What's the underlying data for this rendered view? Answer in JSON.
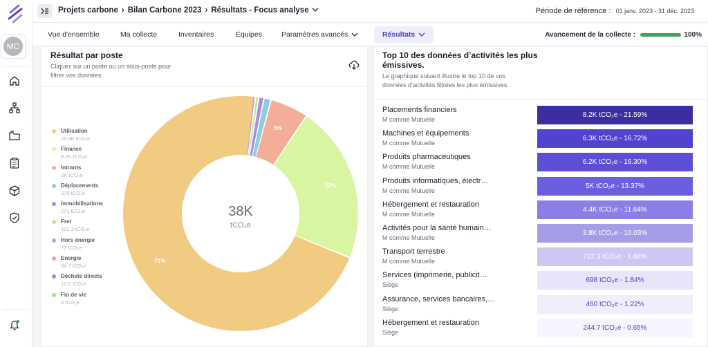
{
  "sidebar": {
    "avatar_initials": "MC",
    "icons": [
      "home-icon",
      "org-chart-icon",
      "folder-icon",
      "clipboard-icon",
      "cube-icon",
      "shield-check-icon",
      "bell-icon"
    ]
  },
  "header": {
    "breadcrumb": [
      "Projets carbone",
      "Bilan Carbone 2023",
      "Résultats - Focus analyse"
    ],
    "period_label": "Période de référence :",
    "period_value": "01 janv. 2023 - 31 déc. 2023"
  },
  "tabs": [
    "Vue d'ensemble",
    "Ma collecte",
    "Inventaires",
    "Équipes",
    "Paramètres avancés",
    "Résultats"
  ],
  "progress": {
    "label": "Avancement de la collecte :",
    "value": 100,
    "text": "100%"
  },
  "left_panel": {
    "title": "Résultat par poste",
    "subtitle_line1": "Cliquez sur un poste ou un sous-poste pour",
    "subtitle_line2": "filtrer vos données.",
    "center_value": "38K",
    "center_unit": "tCO₂e"
  },
  "chart_data": {
    "type": "pie",
    "total": "38K",
    "unit": "tCO₂e",
    "series": [
      {
        "name": "Utilisation",
        "value": 26.8,
        "value_label": "26.8K tCO₂e",
        "color": "#f2cb82",
        "label": "71%"
      },
      {
        "name": "Finance",
        "value": 8.2,
        "value_label": "8.2K tCO₂e",
        "color": "#d8f5a2",
        "label": "22%"
      },
      {
        "name": "Intrants",
        "value": 2.0,
        "value_label": "2K tCO₂e",
        "color": "#f4ae98",
        "label": "5%"
      },
      {
        "name": "Déplacements",
        "value": 0.375,
        "value_label": "375 tCO₂e",
        "color": "#8ecbe4",
        "label": ""
      },
      {
        "name": "Immobilisations",
        "value": 0.271,
        "value_label": "271 tCO₂e",
        "color": "#a58fe4",
        "label": ""
      },
      {
        "name": "Fret",
        "value": 0.1023,
        "value_label": "102.3 tCO₂e",
        "color": "#bde89a",
        "label": ""
      },
      {
        "name": "Hors énergie",
        "value": 0.077,
        "value_label": "77 tCO₂e",
        "color": "#c499e6",
        "label": ""
      },
      {
        "name": "Energie",
        "value": 0.0347,
        "value_label": "34.7 tCO₂e",
        "color": "#f6a09a",
        "label": ""
      },
      {
        "name": "Déchets directs",
        "value": 0.0125,
        "value_label": "12.5 tCO₂e",
        "color": "#8f8fe0",
        "label": ""
      },
      {
        "name": "Fin de vie",
        "value": 0.009,
        "value_label": "9 tCO₂e",
        "color": "#a8e48a",
        "label": ""
      }
    ]
  },
  "right_panel": {
    "title_line1": "Top 10 des données d’activités les plus",
    "title_line2": "émissives.",
    "subtitle_line1": "Le graphique suivant illustre le top 10 de vos",
    "subtitle_line2": "données d'activités filtrées les plus émissives.",
    "rows": [
      {
        "name": "Placements financiers",
        "org": "M comme Mutuelle",
        "value": "8.2K tCO₂e - 21.59%",
        "bg": "#3b2ea0",
        "fg": "#ffffff"
      },
      {
        "name": "Machines et équipements",
        "org": "M comme Mutuelle",
        "value": "6.3K tCO₂e - 16.72%",
        "bg": "#5143cf",
        "fg": "#ffffff"
      },
      {
        "name": "Produits pharmaceutiques",
        "org": "M comme Mutuelle",
        "value": "6.2K tCO₂e - 16.30%",
        "bg": "#5c4fd6",
        "fg": "#ffffff"
      },
      {
        "name": "Produits informatiques, électr…",
        "org": "M comme Mutuelle",
        "value": "5K tCO₂e - 13.37%",
        "bg": "#6b5ee0",
        "fg": "#ffffff"
      },
      {
        "name": "Hébergement et restauration",
        "org": "M comme Mutuelle",
        "value": "4.4K tCO₂e - 11.64%",
        "bg": "#8a7fe6",
        "fg": "#ffffff"
      },
      {
        "name": "Activités pour la santé humain…",
        "org": "M comme Mutuelle",
        "value": "3.8K tCO₂e - 10.03%",
        "bg": "#a59de8",
        "fg": "#ffffff"
      },
      {
        "name": "Transport terrestre",
        "org": "M comme Mutuelle",
        "value": "712.3 tCO₂e - 1.88%",
        "bg": "#cdc8f3",
        "fg": "#ffffff"
      },
      {
        "name": "Services (imprimerie, publicit…",
        "org": "Siège",
        "value": "698 tCO₂e - 1.84%",
        "bg": "#e8e5fb",
        "fg": "#4a3fcf"
      },
      {
        "name": "Assurance, services bancaires,…",
        "org": "Siège",
        "value": "460 tCO₂e - 1.22%",
        "bg": "#f0eefc",
        "fg": "#4a3fcf"
      },
      {
        "name": "Hébergement et restauration",
        "org": "Siège",
        "value": "244.7 tCO₂e - 0.65%",
        "bg": "#f6f5fd",
        "fg": "#4a3fcf"
      }
    ]
  }
}
